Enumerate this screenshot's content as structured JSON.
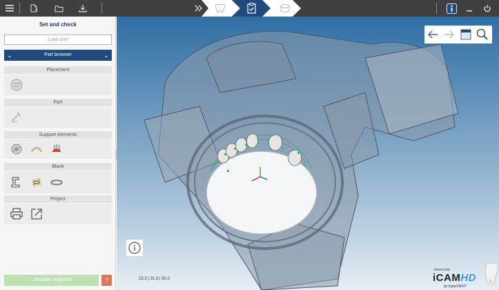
{
  "topbar": {
    "icons": [
      "menu-icon",
      "new-file-icon",
      "open-folder-icon",
      "download-icon",
      "info-icon",
      "minimize-icon",
      "power-icon"
    ],
    "steps": [
      "tooth-icon",
      "checklist-icon",
      "blank-icon"
    ]
  },
  "sidebar": {
    "title": "Set and check",
    "load_part": "Load part",
    "part_browser": "Part browser",
    "sections": {
      "placement": "Placement",
      "part": "Part",
      "support": "Support elements",
      "blank": "Blank",
      "project": "Project"
    },
    "calculate": "Calculate toolpaths",
    "help": "?"
  },
  "viewport": {
    "coords": "23.3 | 21.3 | 30.2",
    "brand": {
      "small": "imes-icore",
      "name_main": "iCAM",
      "name_hd": "HD",
      "by": "by hyperDENT"
    }
  },
  "colors": {
    "topbar": "#404040",
    "nav_blue": "#1f4a7c",
    "calc_green": "#bfe0b0",
    "help_orange": "#e57357",
    "viewport_top": "#2f6ea4"
  }
}
